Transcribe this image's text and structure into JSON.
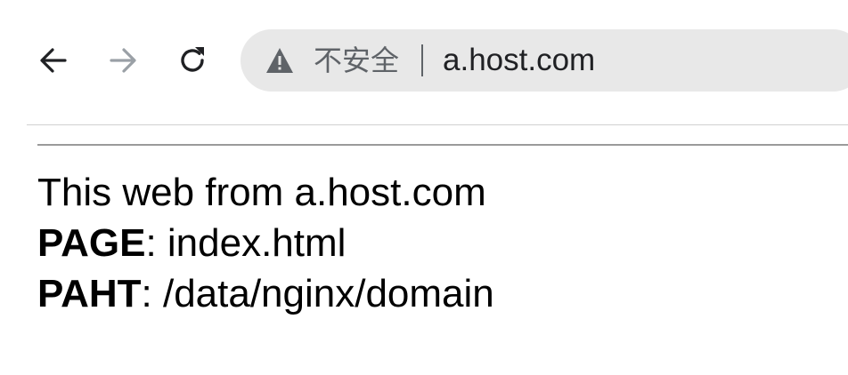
{
  "browser": {
    "address_bar": {
      "security_label": "不安全",
      "url": "a.host.com"
    },
    "icons": {
      "back": "arrow-left-icon",
      "forward": "arrow-right-icon",
      "reload": "reload-icon",
      "security": "warning-triangle-icon"
    },
    "colors": {
      "omnibox_bg": "#e8e8e8",
      "forward_disabled": "#9aa0a6"
    }
  },
  "page": {
    "intro": "This web from a.host.com",
    "page_label": "PAGE",
    "page_value": ": index.html",
    "path_label": "PAHT",
    "path_value": ": /data/nginx/domain"
  }
}
